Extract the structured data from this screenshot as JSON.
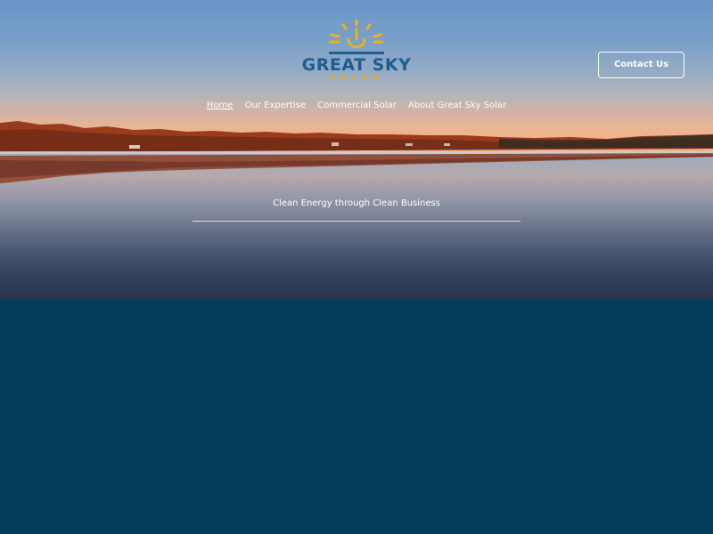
{
  "brand": {
    "name": "GREAT SKY",
    "sub": "SOLAR",
    "sun_color": "#e9b220",
    "text_color": "#1e5d92"
  },
  "header": {
    "contact_label": "Contact Us"
  },
  "nav": {
    "items": [
      {
        "label": "Home",
        "active": true
      },
      {
        "label": "Our Expertise",
        "active": false
      },
      {
        "label": "Commercial Solar",
        "active": false
      },
      {
        "label": "About Great Sky Solar",
        "active": false
      }
    ]
  },
  "hero": {
    "tagline": "Clean Energy through Clean Business"
  },
  "colors": {
    "lower_background": "#033d5a"
  }
}
